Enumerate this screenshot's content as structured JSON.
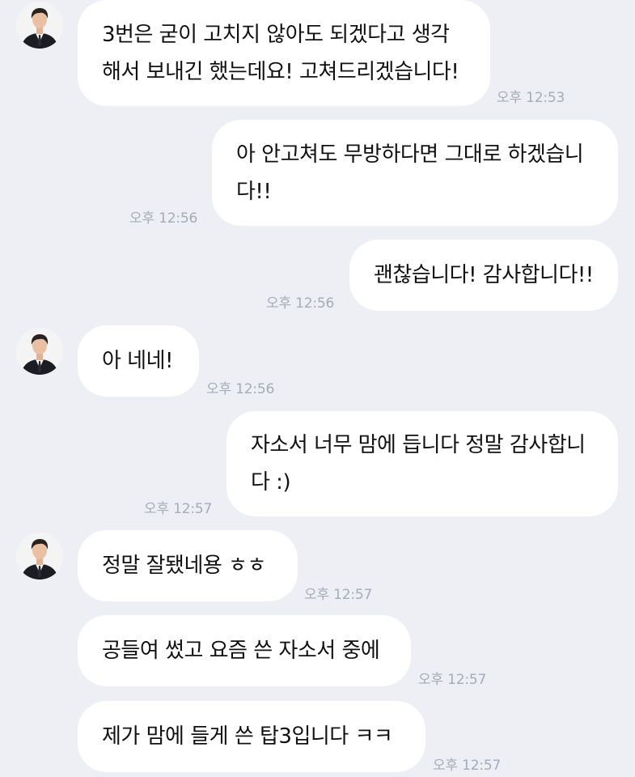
{
  "messages": [
    {
      "sender": "them",
      "text": "3번은 굳이 고치지 않아도 되겠다고 생각\n해서 보내긴 했는데요! 고쳐드리겠습니다!",
      "time": "오후 12:53"
    },
    {
      "sender": "me",
      "text": "아 안고쳐도 무방하다면 그대로 하겠습니\n다!!",
      "time": "오후 12:56"
    },
    {
      "sender": "me",
      "text": "괜찮습니다! 감사합니다!!",
      "time": "오후 12:56"
    },
    {
      "sender": "them",
      "text": "아 네네!",
      "time": "오후 12:56"
    },
    {
      "sender": "me",
      "text": "자소서 너무 맘에 듭니다 정말 감사합니\n다 :)",
      "time": "오후 12:57"
    },
    {
      "sender": "them",
      "text": "정말 잘됐네용 ㅎㅎ",
      "time": "오후 12:57"
    },
    {
      "sender": "them",
      "text": "공들여 썼고 요즘 쓴 자소서 중에",
      "time": "오후 12:57"
    },
    {
      "sender": "them",
      "text": "제가 맘에 들게 쓴 탑3입니다 ㅋㅋ",
      "time": "오후 12:57"
    }
  ],
  "colors": {
    "background": "#edeff5",
    "bubble": "#ffffff",
    "text": "#111111",
    "timestamp": "#a7abb8"
  }
}
